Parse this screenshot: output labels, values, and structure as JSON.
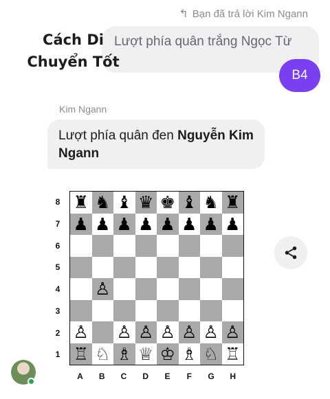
{
  "reply_note": "Bạn đã trả lời Kim Ngann",
  "overlay_title": "Cách Di Chuyển Tốt",
  "quoted_message": "Lượt phía quân trắng Ngọc Từ",
  "outgoing_message": "B4",
  "incoming": {
    "sender": "Kim Ngann",
    "text_prefix": "Lượt phía quân đen ",
    "text_bold": "Nguyễn Kim Ngann"
  },
  "board": {
    "ranks": [
      "8",
      "7",
      "6",
      "5",
      "4",
      "3",
      "2",
      "1"
    ],
    "files": [
      "A",
      "B",
      "C",
      "D",
      "E",
      "F",
      "G",
      "H"
    ],
    "rows": [
      [
        "♜",
        "♞",
        "♝",
        "♛",
        "♚",
        "♝",
        "♞",
        "♜"
      ],
      [
        "♟",
        "♟",
        "♟",
        "♟",
        "♟",
        "♟",
        "♟",
        "♟"
      ],
      [
        "",
        "",
        "",
        "",
        "",
        "",
        "",
        ""
      ],
      [
        "",
        "",
        "",
        "",
        "",
        "",
        "",
        ""
      ],
      [
        "",
        "♙",
        "",
        "",
        "",
        "",
        "",
        ""
      ],
      [
        "",
        "",
        "",
        "",
        "",
        "",
        "",
        ""
      ],
      [
        "♙",
        "",
        "♙",
        "♙",
        "♙",
        "♙",
        "♙",
        "♙"
      ],
      [
        "♖",
        "♘",
        "♗",
        "♕",
        "♔",
        "♗",
        "♘",
        "♖"
      ]
    ],
    "light_color": "#ffffff",
    "dark_color": "#a9a9a9"
  },
  "share_icon": "share-icon",
  "colors": {
    "accent": "#7b3ff2",
    "bubble_gray": "#eff0f2",
    "online": "#31a24c"
  }
}
